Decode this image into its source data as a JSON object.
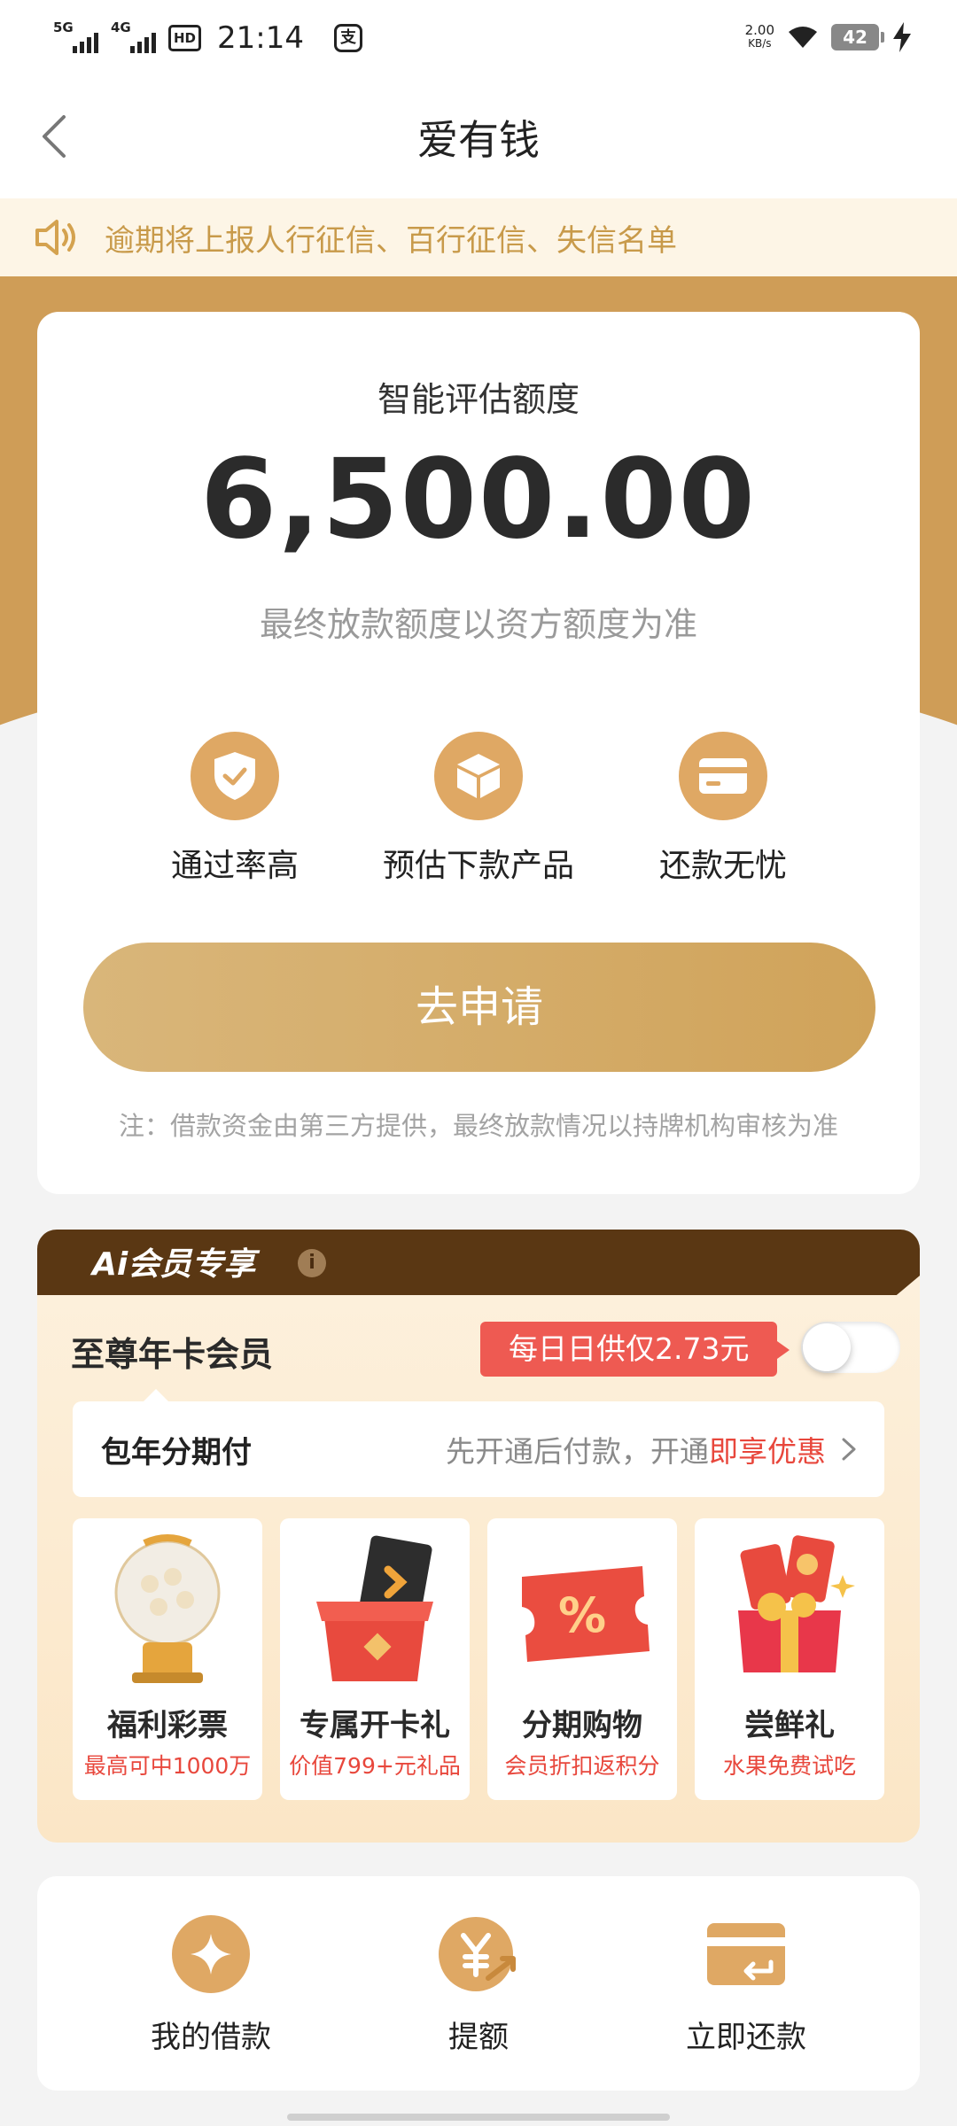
{
  "status_bar": {
    "net1": "5G",
    "net2": "4G",
    "hd": "HD",
    "time": "21:14",
    "app_badge": "支",
    "speed_value": "2.00",
    "speed_unit": "KB/s",
    "battery": "42"
  },
  "nav": {
    "title": "爱有钱"
  },
  "notice": {
    "text": "逾期将上报人行征信、百行征信、失信名单"
  },
  "quota": {
    "label": "智能评估额度",
    "amount": "6,500.00",
    "sub": "最终放款额度以资方额度为准",
    "features": [
      {
        "label": "通过率高",
        "icon": "shield-check-icon"
      },
      {
        "label": "预估下款产品",
        "icon": "box-icon"
      },
      {
        "label": "还款无忧",
        "icon": "card-icon"
      }
    ],
    "apply_label": "去申请",
    "note": "注：借款资金由第三方提供，最终放款情况以持牌机构审核为准"
  },
  "member": {
    "tab_title": "Ai会员专享",
    "info": "i",
    "plan_name": "至尊年卡会员",
    "daily_tag": "每日日供仅2.73元",
    "toggle_on": false,
    "row_left": "包年分期付",
    "row_right_prefix": "先开通后付款，开通",
    "row_right_highlight": "即享优惠",
    "benefits": [
      {
        "title": "福利彩票",
        "sub": "最高可中1000万",
        "icon": "lottery-icon"
      },
      {
        "title": "专属开卡礼",
        "sub": "价值799+元礼品",
        "icon": "gift-box-icon"
      },
      {
        "title": "分期购物",
        "sub": "会员折扣返积分",
        "icon": "coupon-icon"
      },
      {
        "title": "尝鲜礼",
        "sub": "水果免费试吃",
        "icon": "red-envelope-icon"
      }
    ]
  },
  "shortcuts": [
    {
      "label": "我的借款",
      "icon": "loan-icon"
    },
    {
      "label": "提额",
      "icon": "yuan-raise-icon"
    },
    {
      "label": "立即还款",
      "icon": "repay-card-icon"
    }
  ],
  "colors": {
    "brand_gold": "#cf9d57",
    "notice_text": "#c89a4a",
    "highlight_red": "#e8473c"
  }
}
